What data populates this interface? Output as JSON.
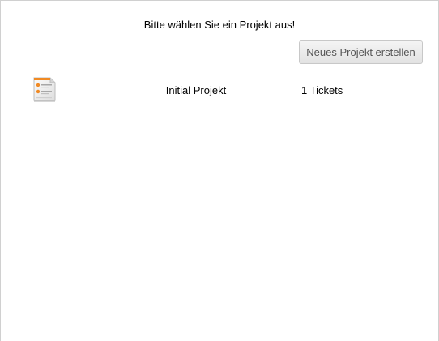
{
  "page": {
    "heading": "Bitte wählen Sie ein Projekt aus!",
    "new_project_button": "Neues Projekt erstellen"
  },
  "projects": [
    {
      "icon": "project-document-icon",
      "name": "Initial Projekt",
      "tickets": "1 Tickets"
    }
  ],
  "colors": {
    "icon_accent": "#f08a24",
    "button_text": "#555555",
    "border": "#d0d0d0"
  }
}
